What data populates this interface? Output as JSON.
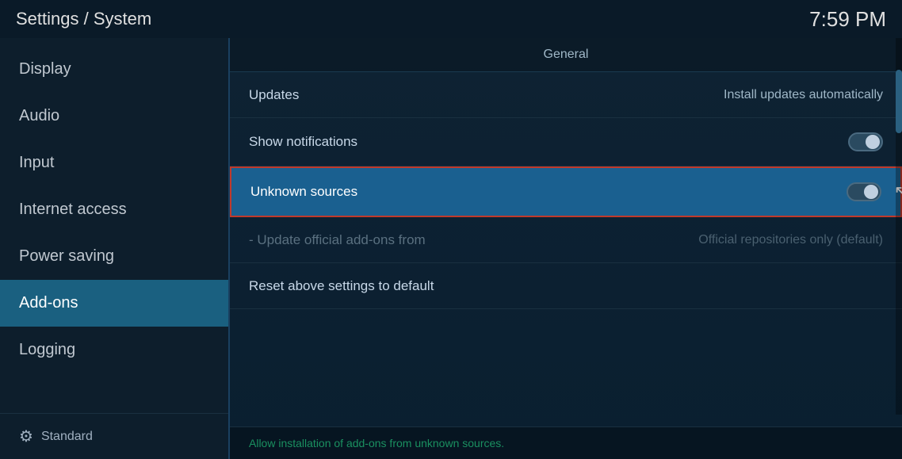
{
  "header": {
    "title": "Settings / System",
    "time": "7:59 PM"
  },
  "sidebar": {
    "items": [
      {
        "id": "display",
        "label": "Display",
        "active": false
      },
      {
        "id": "audio",
        "label": "Audio",
        "active": false
      },
      {
        "id": "input",
        "label": "Input",
        "active": false
      },
      {
        "id": "internet-access",
        "label": "Internet access",
        "active": false
      },
      {
        "id": "power-saving",
        "label": "Power saving",
        "active": false
      },
      {
        "id": "add-ons",
        "label": "Add-ons",
        "active": true
      },
      {
        "id": "logging",
        "label": "Logging",
        "active": false
      }
    ],
    "footer_label": "Standard"
  },
  "content": {
    "section_title": "General",
    "settings": [
      {
        "id": "updates",
        "label": "Updates",
        "value": "Install updates automatically",
        "type": "value",
        "highlighted": false,
        "dimmed": false
      },
      {
        "id": "show-notifications",
        "label": "Show notifications",
        "value": "",
        "type": "toggle",
        "toggle_state": "off",
        "highlighted": false,
        "dimmed": false
      },
      {
        "id": "unknown-sources",
        "label": "Unknown sources",
        "value": "",
        "type": "toggle",
        "toggle_state": "off",
        "highlighted": true,
        "dimmed": false
      },
      {
        "id": "update-addons-from",
        "label": "- Update official add-ons from",
        "value": "Official repositories only (default)",
        "type": "value",
        "highlighted": false,
        "dimmed": true
      },
      {
        "id": "reset-settings",
        "label": "Reset above settings to default",
        "value": "",
        "type": "action",
        "highlighted": false,
        "dimmed": false
      }
    ],
    "bottom_notice": "Allow installation of add-ons from unknown sources."
  }
}
